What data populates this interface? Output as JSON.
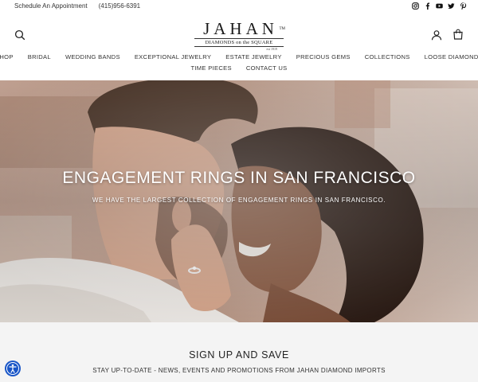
{
  "topbar": {
    "appointment": "Schedule An Appointment",
    "phone": "(415)956-6391",
    "social": [
      "instagram-icon",
      "facebook-icon",
      "youtube-icon",
      "twitter-icon",
      "pinterest-icon"
    ]
  },
  "logo": {
    "brand": "JAHAN",
    "tm": "TM",
    "tagline": "DIAMONDS on the SQUARE",
    "est": "est 1919"
  },
  "nav": {
    "row1": [
      "SHOP",
      "BRIDAL",
      "WEDDING BANDS",
      "EXCEPTIONAL JEWELRY",
      "ESTATE JEWELRY",
      "PRECIOUS GEMS",
      "COLLECTIONS",
      "LOOSE DIAMONDS"
    ],
    "row2": [
      "TIME PIECES",
      "CONTACT US"
    ]
  },
  "hero": {
    "title": "ENGAGEMENT RINGS IN SAN FRANCISCO",
    "subtitle": "WE HAVE THE LARGEST COLLECTION OF ENGAGEMENT RINGS IN SAN FRANCISCO."
  },
  "signup": {
    "title": "SIGN UP AND SAVE",
    "text": "STAY UP-TO-DATE - NEWS, EVENTS AND PROMOTIONS FROM JAHAN DIAMOND IMPORTS"
  },
  "colors": {
    "accessibility": "#1a56c7",
    "signup_bg": "#f4f4f4"
  }
}
